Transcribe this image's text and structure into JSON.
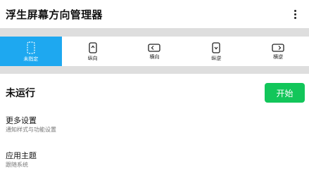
{
  "appbar": {
    "title": "浮生屏幕方向管理器",
    "menu_icon": "more-vert-icon"
  },
  "modes": [
    {
      "label": "未指定",
      "icon": "dashed-phone-icon",
      "active": true
    },
    {
      "label": "纵向",
      "icon": "portrait-icon",
      "active": false
    },
    {
      "label": "横向",
      "icon": "landscape-icon",
      "active": false
    },
    {
      "label": "纵逆",
      "icon": "reverse-portrait-icon",
      "active": false
    },
    {
      "label": "横逆",
      "icon": "reverse-landscape-icon",
      "active": false
    }
  ],
  "status": {
    "text": "未运行",
    "start_label": "开始"
  },
  "settings": [
    {
      "title": "更多设置",
      "subtitle": "通知样式与功能设置"
    },
    {
      "title": "应用主题",
      "subtitle": "跟随系统"
    }
  ],
  "colors": {
    "accent": "#1ea8f0",
    "start_button": "#12c65a",
    "divider": "#dedede"
  }
}
